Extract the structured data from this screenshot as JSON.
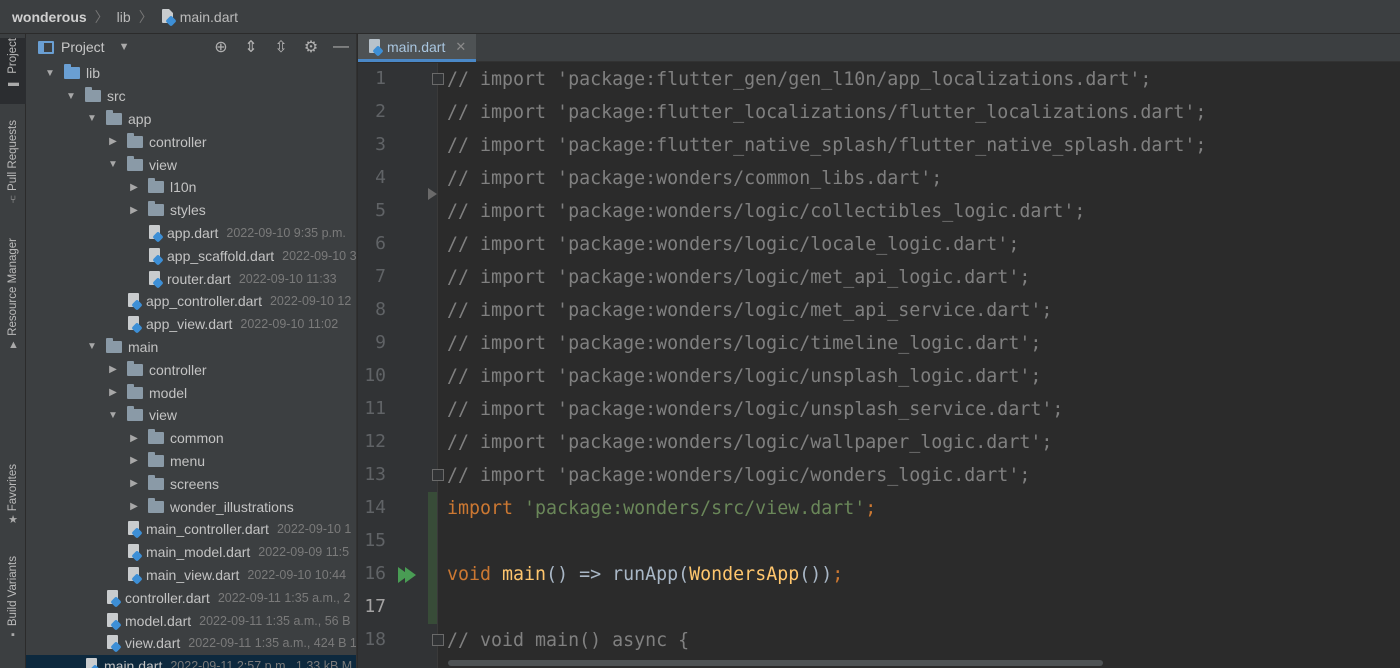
{
  "breadcrumb": {
    "project": "wonderous",
    "folder": "lib",
    "file": "main.dart"
  },
  "toolstrip": {
    "tabs": [
      {
        "label": "Project",
        "icon": "folder-icon"
      },
      {
        "label": "Pull Requests",
        "icon": "pull-request-icon"
      },
      {
        "label": "Resource Manager",
        "icon": "resource-icon"
      },
      {
        "label": "Favorites",
        "icon": "star-icon"
      },
      {
        "label": "Build Variants",
        "icon": "build-icon"
      }
    ]
  },
  "project_panel": {
    "title": "Project",
    "icons": [
      "locate-icon",
      "expand-all-icon",
      "collapse-all-icon",
      "gear-icon",
      "minimize-icon"
    ],
    "tree": [
      {
        "depth": 1,
        "type": "folder",
        "expanded": true,
        "name": "lib",
        "blue": true
      },
      {
        "depth": 2,
        "type": "folder",
        "expanded": true,
        "name": "src"
      },
      {
        "depth": 3,
        "type": "folder",
        "expanded": true,
        "name": "app"
      },
      {
        "depth": 4,
        "type": "folder",
        "expanded": false,
        "name": "controller"
      },
      {
        "depth": 4,
        "type": "folder",
        "expanded": true,
        "name": "view"
      },
      {
        "depth": 5,
        "type": "folder",
        "expanded": false,
        "name": "l10n"
      },
      {
        "depth": 5,
        "type": "folder",
        "expanded": false,
        "name": "styles"
      },
      {
        "depth": 5,
        "type": "file",
        "name": "app.dart",
        "meta": "2022-09-10 9:35 p.m."
      },
      {
        "depth": 5,
        "type": "file",
        "name": "app_scaffold.dart",
        "meta": "2022-09-10 3"
      },
      {
        "depth": 5,
        "type": "file",
        "name": "router.dart",
        "meta": "2022-09-10 11:33"
      },
      {
        "depth": 4,
        "type": "file",
        "name": "app_controller.dart",
        "meta": "2022-09-10 12"
      },
      {
        "depth": 4,
        "type": "file",
        "name": "app_view.dart",
        "meta": "2022-09-10 11:02"
      },
      {
        "depth": 3,
        "type": "folder",
        "expanded": true,
        "name": "main"
      },
      {
        "depth": 4,
        "type": "folder",
        "expanded": false,
        "name": "controller"
      },
      {
        "depth": 4,
        "type": "folder",
        "expanded": false,
        "name": "model"
      },
      {
        "depth": 4,
        "type": "folder",
        "expanded": true,
        "name": "view"
      },
      {
        "depth": 5,
        "type": "folder",
        "expanded": false,
        "name": "common"
      },
      {
        "depth": 5,
        "type": "folder",
        "expanded": false,
        "name": "menu"
      },
      {
        "depth": 5,
        "type": "folder",
        "expanded": false,
        "name": "screens"
      },
      {
        "depth": 5,
        "type": "folder",
        "expanded": false,
        "name": "wonder_illustrations"
      },
      {
        "depth": 4,
        "type": "file",
        "name": "main_controller.dart",
        "meta": "2022-09-10 1"
      },
      {
        "depth": 4,
        "type": "file",
        "name": "main_model.dart",
        "meta": "2022-09-09 11:5"
      },
      {
        "depth": 4,
        "type": "file",
        "name": "main_view.dart",
        "meta": "2022-09-10 10:44"
      },
      {
        "depth": 3,
        "type": "file",
        "name": "controller.dart",
        "meta": "2022-09-11 1:35 a.m., 2"
      },
      {
        "depth": 3,
        "type": "file",
        "name": "model.dart",
        "meta": "2022-09-11 1:35 a.m., 56 B"
      },
      {
        "depth": 3,
        "type": "file",
        "name": "view.dart",
        "meta": "2022-09-11 1:35 a.m., 424 B 1"
      },
      {
        "depth": 2,
        "type": "file",
        "name": "main.dart",
        "meta": "2022-09-11 2:57 p.m., 1.33 kB M",
        "selected": true
      }
    ]
  },
  "editor": {
    "tab_label": "main.dart",
    "current_line": 17,
    "lines": [
      {
        "n": 1,
        "parts": [
          [
            "c-comment",
            "// import 'package:flutter_gen/gen_l10n/app_localizations.dart';"
          ]
        ]
      },
      {
        "n": 2,
        "parts": [
          [
            "c-comment",
            "// import 'package:flutter_localizations/flutter_localizations.dart';"
          ]
        ]
      },
      {
        "n": 3,
        "parts": [
          [
            "c-comment",
            "// import 'package:flutter_native_splash/flutter_native_splash.dart';"
          ]
        ]
      },
      {
        "n": 4,
        "parts": [
          [
            "c-comment",
            "// import 'package:wonders/common_libs.dart';"
          ]
        ]
      },
      {
        "n": 5,
        "parts": [
          [
            "c-comment",
            "// import 'package:wonders/logic/collectibles_logic.dart';"
          ]
        ]
      },
      {
        "n": 6,
        "parts": [
          [
            "c-comment",
            "// import 'package:wonders/logic/locale_logic.dart';"
          ]
        ]
      },
      {
        "n": 7,
        "parts": [
          [
            "c-comment",
            "// import 'package:wonders/logic/met_api_logic.dart';"
          ]
        ]
      },
      {
        "n": 8,
        "parts": [
          [
            "c-comment",
            "// import 'package:wonders/logic/met_api_service.dart';"
          ]
        ]
      },
      {
        "n": 9,
        "parts": [
          [
            "c-comment",
            "// import 'package:wonders/logic/timeline_logic.dart';"
          ]
        ]
      },
      {
        "n": 10,
        "parts": [
          [
            "c-comment",
            "// import 'package:wonders/logic/unsplash_logic.dart';"
          ]
        ]
      },
      {
        "n": 11,
        "parts": [
          [
            "c-comment",
            "// import 'package:wonders/logic/unsplash_service.dart';"
          ]
        ]
      },
      {
        "n": 12,
        "parts": [
          [
            "c-comment",
            "// import 'package:wonders/logic/wallpaper_logic.dart';"
          ]
        ]
      },
      {
        "n": 13,
        "parts": [
          [
            "c-comment",
            "// import 'package:wonders/logic/wonders_logic.dart';"
          ]
        ]
      },
      {
        "n": 14,
        "parts": [
          [
            "c-kw",
            "import "
          ],
          [
            "c-str",
            "'package:wonders/src/view.dart'"
          ],
          [
            "c-kw",
            ";"
          ]
        ]
      },
      {
        "n": 15,
        "parts": []
      },
      {
        "n": 16,
        "parts": [
          [
            "c-kw",
            "void "
          ],
          [
            "c-fn",
            "main"
          ],
          [
            "c-plain",
            "() => runApp("
          ],
          [
            "c-fn",
            "WondersApp"
          ],
          [
            "c-plain",
            "())"
          ],
          [
            "c-kw",
            ";"
          ]
        ]
      },
      {
        "n": 17,
        "parts": []
      },
      {
        "n": 18,
        "parts": [
          [
            "c-comment",
            "// void main() async {"
          ]
        ]
      }
    ]
  }
}
